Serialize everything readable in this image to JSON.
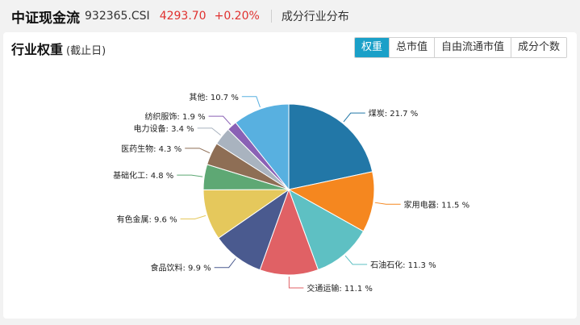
{
  "header": {
    "index_name": "中证现金流",
    "index_code": "932365.CSI",
    "price": "4293.70",
    "change": "+0.20%",
    "section": "成分行业分布"
  },
  "card": {
    "title": "行业权重",
    "subtitle": "(截止日)",
    "tabs": [
      {
        "label": "权重",
        "active": true
      },
      {
        "label": "总市值",
        "active": false
      },
      {
        "label": "自由流通市值",
        "active": false
      },
      {
        "label": "成分个数",
        "active": false
      }
    ]
  },
  "chart_data": {
    "type": "pie",
    "slices": [
      {
        "name": "煤炭",
        "value": 21.7,
        "color": "#2277a7"
      },
      {
        "name": "家用电器",
        "value": 11.5,
        "color": "#f5871f"
      },
      {
        "name": "石油石化",
        "value": 11.3,
        "color": "#5ec0c3"
      },
      {
        "name": "交通运输",
        "value": 11.1,
        "color": "#e06165"
      },
      {
        "name": "食品饮料",
        "value": 9.9,
        "color": "#4a5a8f"
      },
      {
        "name": "有色金属",
        "value": 9.6,
        "color": "#e5c85c"
      },
      {
        "name": "基础化工",
        "value": 4.8,
        "color": "#5ea874"
      },
      {
        "name": "医药生物",
        "value": 4.3,
        "color": "#8e6e55"
      },
      {
        "name": "电力设备",
        "value": 3.4,
        "color": "#a9b3bf"
      },
      {
        "name": "纺织服饰",
        "value": 1.9,
        "color": "#8a61b5"
      },
      {
        "name": "其他",
        "value": 10.7,
        "color": "#58b0e0"
      }
    ],
    "label_suffix": " %",
    "start_angle_deg": -90,
    "direction": "clockwise"
  }
}
